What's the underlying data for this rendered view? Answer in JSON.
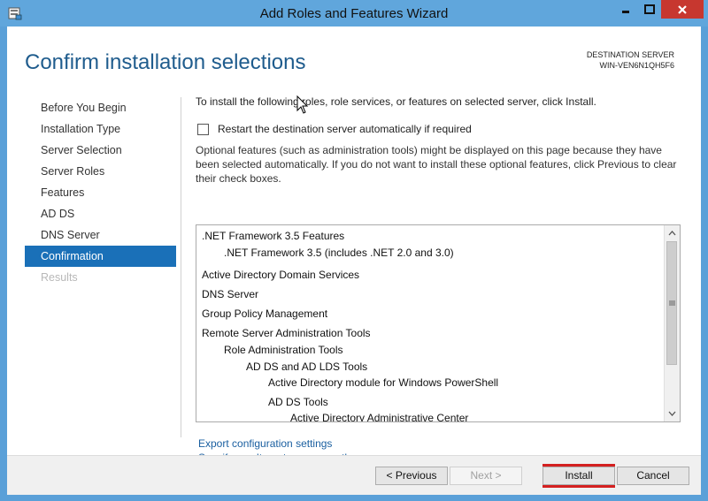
{
  "window": {
    "title": "Add Roles and Features Wizard"
  },
  "header": {
    "page_title": "Confirm installation selections",
    "destination_label": "DESTINATION SERVER",
    "destination_server": "WIN-VEN6N1QH5F6"
  },
  "sidebar": {
    "items": [
      {
        "label": "Before You Begin",
        "state": "normal"
      },
      {
        "label": "Installation Type",
        "state": "normal"
      },
      {
        "label": "Server Selection",
        "state": "normal"
      },
      {
        "label": "Server Roles",
        "state": "normal"
      },
      {
        "label": "Features",
        "state": "normal"
      },
      {
        "label": "AD DS",
        "state": "normal"
      },
      {
        "label": "DNS Server",
        "state": "normal"
      },
      {
        "label": "Confirmation",
        "state": "active"
      },
      {
        "label": "Results",
        "state": "disabled"
      }
    ]
  },
  "main": {
    "intro": "To install the following roles, role services, or features on selected server, click Install.",
    "restart_checkbox_label": "Restart the destination server automatically if required",
    "restart_checked": false,
    "optional_note": "Optional features (such as administration tools) might be displayed on this page because they have been selected automatically. If you do not want to install these optional features, click Previous to clear their check boxes.",
    "features": [
      {
        "label": ".NET Framework 3.5 Features",
        "level": 0
      },
      {
        "label": ".NET Framework 3.5 (includes .NET 2.0 and 3.0)",
        "level": 1
      },
      {
        "label": "Active Directory Domain Services",
        "level": 0
      },
      {
        "label": "DNS Server",
        "level": 0
      },
      {
        "label": "Group Policy Management",
        "level": 0
      },
      {
        "label": "Remote Server Administration Tools",
        "level": 0
      },
      {
        "label": "Role Administration Tools",
        "level": 1
      },
      {
        "label": "AD DS and AD LDS Tools",
        "level": 2
      },
      {
        "label": "Active Directory module for Windows PowerShell",
        "level": 3
      },
      {
        "label": "AD DS Tools",
        "level": 3
      },
      {
        "label": "Active Directory Administrative Center",
        "level": 4
      }
    ],
    "links": {
      "export": "Export configuration settings",
      "alternate_source": "Specify an alternate source path"
    }
  },
  "footer": {
    "previous_label": "< Previous",
    "next_label": "Next >",
    "install_label": "Install",
    "cancel_label": "Cancel"
  },
  "colors": {
    "accent": "#1a70b8",
    "title_blue": "#1f5c8d",
    "highlight_red": "#d42020"
  }
}
